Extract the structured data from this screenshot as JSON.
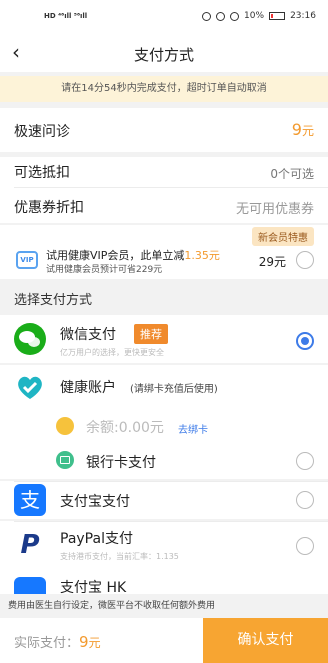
{
  "status_bar": {
    "left_text": "HD ⁴⁶ıll ⁵⁶ıll",
    "battery": "10%",
    "time": "23:16"
  },
  "nav": {
    "title": "支付方式"
  },
  "notice": "请在14分54秒内完成支付，超时订单自动取消",
  "order": {
    "service_label": "极速问诊",
    "service_price": "9",
    "service_price_unit": "元",
    "deduct_label": "可选抵扣",
    "deduct_value": "0个可选",
    "coupon_label": "优惠券折扣",
    "coupon_value": "无可用优惠券"
  },
  "vip": {
    "tag": "新会员特惠",
    "icon_text": "VIP",
    "line1_prefix": "试用健康VIP会员，此单立减",
    "line1_amount": "1.35元",
    "line2": "试用健康会员预计可省229元",
    "price": "29元"
  },
  "pay_section_title": "选择支付方式",
  "payments": {
    "wechat": {
      "name": "微信支付",
      "tag": "推荐",
      "sub": "亿万用户的选择，更快更安全",
      "selected": true
    },
    "health": {
      "name": "健康账户",
      "hint": "(请绑卡充值后使用)"
    },
    "balance": {
      "label": "余额:0.00元",
      "link": "去绑卡"
    },
    "bankcard": {
      "name": "银行卡支付"
    },
    "alipay": {
      "name": "支付宝支付"
    },
    "paypal": {
      "name": "PayPal支付",
      "sub": "支持港币支付，当前汇率：1.135"
    },
    "alipay_hk": {
      "name": "支付宝 HK"
    }
  },
  "footer_note": "费用由医生自行设定，微医平台不收取任何额外费用",
  "bottom": {
    "actual_label": "实际支付：",
    "actual_amount": "9",
    "actual_unit": "元",
    "confirm": "确认支付"
  },
  "colors": {
    "accent": "#f39a2e",
    "primary_blue": "#3d7be8",
    "wechat_green": "#1aad19",
    "alipay_blue": "#1678ff",
    "paypal_navy": "#1b3a8a"
  }
}
